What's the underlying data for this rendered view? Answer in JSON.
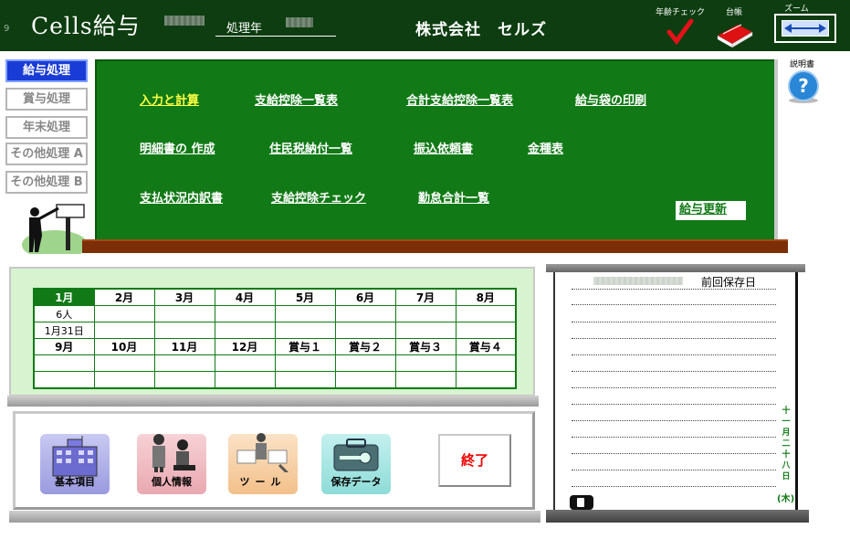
{
  "header": {
    "corner_digit": "9",
    "app_title": "Cells給与",
    "processing_year_label": "処理年",
    "company_name": "株式会社　セルズ",
    "age_check_label": "年齢チェック",
    "ledger_label": "台帳",
    "zoom_label": "ズーム"
  },
  "nav": {
    "items": [
      {
        "label": "給与処理",
        "active": true
      },
      {
        "label": "賞与処理",
        "active": false
      },
      {
        "label": "年末処理",
        "active": false
      },
      {
        "label": "その他処理 A",
        "active": false
      },
      {
        "label": "その他処理 B",
        "active": false
      }
    ]
  },
  "board": {
    "links": [
      {
        "label": "入力と計算",
        "highlight": true
      },
      {
        "label": "支給控除一覧表"
      },
      {
        "label": "合計支給控除一覧表"
      },
      {
        "label": "給与袋の印刷"
      },
      {
        "label": "明細書の 作成"
      },
      {
        "label": "住民税納付一覧"
      },
      {
        "label": "振込依頼書"
      },
      {
        "label": "金種表"
      },
      {
        "label": "支払状況内訳書"
      },
      {
        "label": "支給控除チェック"
      },
      {
        "label": "勤怠合計一覧"
      }
    ],
    "update_label": "給与更新"
  },
  "help": {
    "label": "説明書"
  },
  "months": {
    "row1": [
      "1月",
      "2月",
      "3月",
      "4月",
      "5月",
      "6月",
      "7月",
      "8月"
    ],
    "row1_people": [
      "6人",
      "",
      "",
      "",
      "",
      "",
      "",
      ""
    ],
    "row1_dates": [
      "1月31日",
      "",
      "",
      "",
      "",
      "",
      "",
      ""
    ],
    "row2": [
      "9月",
      "10月",
      "11月",
      "12月",
      "賞与１",
      "賞与２",
      "賞与３",
      "賞与４"
    ],
    "selected_index": 0
  },
  "tools": {
    "basic_items": "基本項目",
    "personal_info": "個人情報",
    "tools": "ツール",
    "save_data": "保存データ",
    "exit": "終了"
  },
  "memo": {
    "last_saved_label": "前回保存日",
    "date_vertical": [
      "十",
      "一",
      "月",
      "二",
      "十",
      "八",
      "日"
    ],
    "day_of_week": "(木)"
  },
  "colors": {
    "header_bg": "#0d3d10",
    "board_green": "#117a16",
    "nav_active": "#1a3cd6",
    "exit_red": "#e00000"
  }
}
